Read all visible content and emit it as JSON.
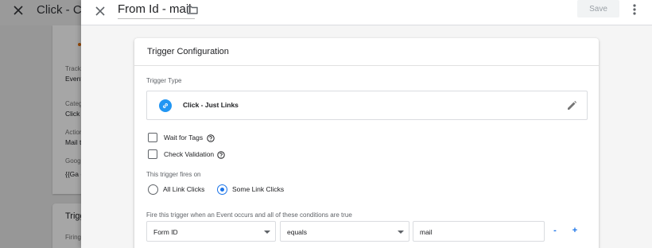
{
  "background": {
    "title": "Click - Co",
    "card1": {
      "fields": [
        {
          "label": "Track",
          "value": "Event"
        },
        {
          "label": "Categ",
          "value": "Click"
        },
        {
          "label": "Action",
          "value": "Mail t"
        },
        {
          "label": "Googl",
          "value": "{{Ga -"
        }
      ]
    },
    "card2": {
      "heading": "Trigg",
      "label": "Firing"
    }
  },
  "header": {
    "trigger_name": "From Id - mail",
    "save_label": "Save"
  },
  "card": {
    "title": "Trigger Configuration",
    "trigger_type_label": "Trigger Type",
    "trigger_type_name": "Click - Just Links",
    "wait_for_tags_label": "Wait for Tags",
    "wait_for_tags_checked": false,
    "check_validation_label": "Check Validation",
    "check_validation_checked": false,
    "fires_on_label": "This trigger fires on",
    "fires_on_options": [
      {
        "label": "All Link Clicks",
        "selected": false
      },
      {
        "label": "Some Link Clicks",
        "selected": true
      }
    ],
    "condition_label": "Fire this trigger when an Event occurs and all of these conditions are true",
    "condition": {
      "variable": "Form ID",
      "operator": "equals",
      "value": "mail",
      "remove_label": "-",
      "add_label": "+"
    }
  },
  "colors": {
    "accent": "#1a73e8",
    "trigger_icon": "#2196f3",
    "background_dim": "#e8e8e8"
  }
}
